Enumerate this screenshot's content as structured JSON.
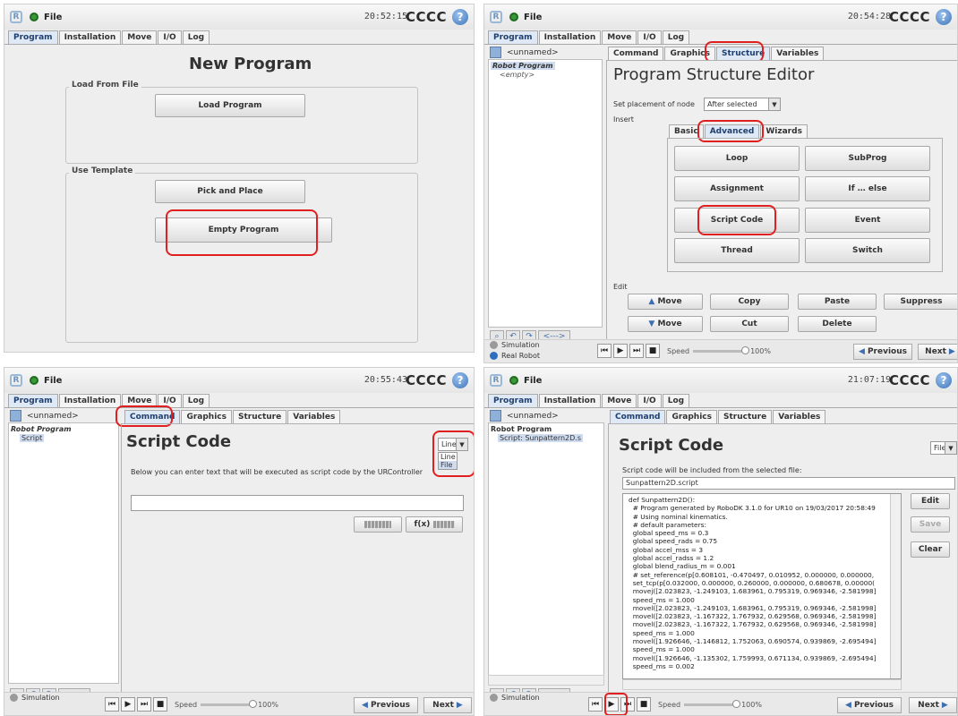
{
  "common": {
    "file_label": "File",
    "brand": "CCCC",
    "help": "?",
    "tabs": [
      "Program",
      "Installation",
      "Move",
      "I/O",
      "Log"
    ],
    "unnamed": "<unnamed>",
    "robot_program": "Robot Program",
    "modes": [
      "Simulation",
      "Real Robot"
    ],
    "speed_label": "Speed",
    "speed_value": "100%",
    "previous": "Previous",
    "next": "Next",
    "nav_range": "<--->",
    "accent_red": "#e02020",
    "tab_active_color": "#dfe8f5"
  },
  "panel1": {
    "time": "20:52:15",
    "title": "New Program",
    "load_group": "Load From File",
    "load_button": "Load Program",
    "template_group": "Use Template",
    "pick_button": "Pick and Place",
    "empty_button": "Empty Program"
  },
  "panel2": {
    "time": "20:54:28",
    "subtabs": [
      "Command",
      "Graphics",
      "Structure",
      "Variables"
    ],
    "empty_node": "<empty>",
    "title": "Program Structure Editor",
    "placement_label": "Set placement of node",
    "placement_value": "After selected",
    "insert_label": "Insert",
    "insert_tabs": [
      "Basic",
      "Advanced",
      "Wizards"
    ],
    "buttons": [
      "Loop",
      "SubProg",
      "Assignment",
      "If … else",
      "Script Code",
      "Event",
      "Thread",
      "Switch"
    ],
    "edit_label": "Edit",
    "edit_buttons": [
      "Move",
      "Copy",
      "Paste",
      "Suppress",
      "Move",
      "Cut",
      "Delete"
    ]
  },
  "panel3": {
    "time": "20:55:43",
    "subtabs": [
      "Command",
      "Graphics",
      "Structure",
      "Variables"
    ],
    "tree_script": "Script",
    "title": "Script Code",
    "mode_value": "Line",
    "mode_options": [
      "Line",
      "File"
    ],
    "description": "Below you can enter text that will be executed as script code by the URController",
    "fx_button": "f(x)"
  },
  "panel4": {
    "time": "21:07:19",
    "subtabs": [
      "Command",
      "Graphics",
      "Structure",
      "Variables"
    ],
    "tree_script": "Script: Sunpattern2D.s",
    "title": "Script Code",
    "mode_value": "File",
    "description": "Script code will be included from the selected file:",
    "filename": "Sunpattern2D.script",
    "code_lines": [
      "def Sunpattern2D():",
      "  # Program generated by RoboDK 3.1.0 for UR10 on 19/03/2017 20:58:49",
      "  # Using nominal kinematics.",
      "  # default parameters:",
      "  global speed_ms = 0.3",
      "  global speed_rads = 0.75",
      "  global accel_mss = 3",
      "  global accel_radss = 1.2",
      "  global blend_radius_m = 0.001",
      "  # set_reference(p[0.608101, -0.470497, 0.010952, 0.000000, 0.000000,",
      "  set_tcp(p[0.032000, 0.000000, 0.260000, 0.000000, 0.680678, 0.00000(",
      "  movej([2.023823, -1.249103, 1.683961, 0.795319, 0.969346, -2.581998]",
      "  speed_ms = 1.000",
      "  movel([2.023823, -1.249103, 1.683961, 0.795319, 0.969346, -2.581998]",
      "  movel([2.023823, -1.167322, 1.767932, 0.629568, 0.969346, -2.581998]",
      "  movel([2.023823, -1.167322, 1.767932, 0.629568, 0.969346, -2.581998]",
      "  speed_ms = 1.000",
      "  movel([1.926646, -1.146812, 1.752063, 0.690574, 0.939869, -2.695494]",
      "  speed_ms = 1.000",
      "  movel([1.926646, -1.135302, 1.759993, 0.671134, 0.939869, -2.695494]",
      "  speed_ms = 0.002"
    ],
    "edit_button": "Edit",
    "save_button": "Save",
    "clear_button": "Clear"
  }
}
